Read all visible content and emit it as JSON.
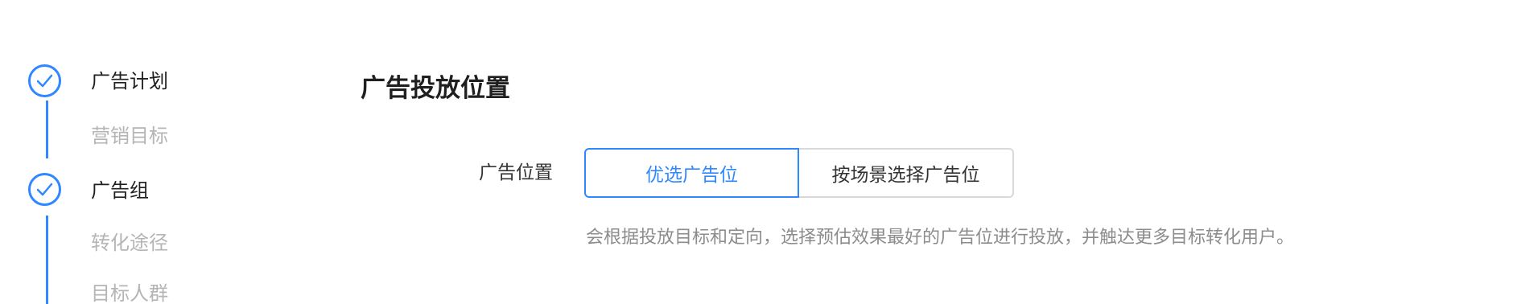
{
  "steps": [
    {
      "label": "广告计划",
      "state": "done",
      "kind": "main"
    },
    {
      "label": "营销目标",
      "state": "pending",
      "kind": "sub"
    },
    {
      "label": "广告组",
      "state": "done",
      "kind": "main"
    },
    {
      "label": "转化途径",
      "state": "pending",
      "kind": "sub"
    },
    {
      "label": "目标人群",
      "state": "pending",
      "kind": "sub"
    }
  ],
  "main": {
    "section_title": "广告投放位置",
    "placement": {
      "label": "广告位置",
      "options": [
        {
          "label": "优选广告位",
          "selected": true
        },
        {
          "label": "按场景选择广告位",
          "selected": false
        }
      ],
      "hint": "会根据投放目标和定向，选择预估效果最好的广告位进行投放，并触达更多目标转化用户。"
    }
  },
  "colors": {
    "accent": "#2f88ff",
    "text_primary": "#1f1f1f",
    "text_muted": "#b5b5b5",
    "hint": "#8c8c8c",
    "border": "#d9d9d9"
  },
  "icons": {
    "step_done": "check-circle-icon"
  }
}
